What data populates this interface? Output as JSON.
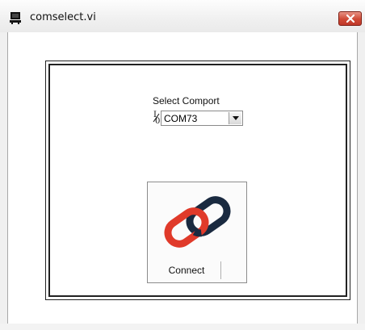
{
  "window": {
    "title": "comselect.vi",
    "close_icon": "close-icon",
    "app_icon": "labview-vi-icon"
  },
  "panel": {
    "comport_label": "Select Comport",
    "io_glyph": "I/O",
    "comport_value": "COM73",
    "connect_label": "Connect",
    "connect_icon": "link-icon"
  },
  "colors": {
    "close_button": "#cf4a35",
    "link_red": "#e03a2a",
    "link_navy": "#1a2a40"
  }
}
